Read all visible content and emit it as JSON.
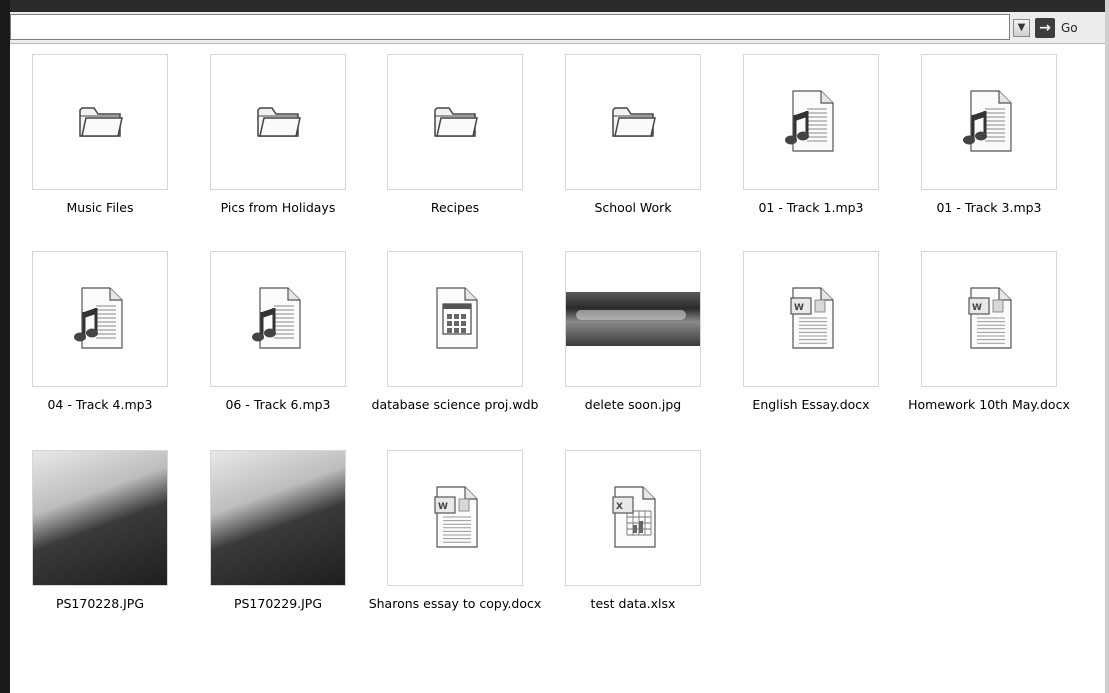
{
  "address_bar": {
    "go_label": "Go"
  },
  "items": [
    {
      "name": "Music Files",
      "kind": "folder"
    },
    {
      "name": "Pics from Holidays",
      "kind": "folder"
    },
    {
      "name": "Recipes",
      "kind": "folder"
    },
    {
      "name": "School Work",
      "kind": "folder"
    },
    {
      "name": "01 - Track 1.mp3",
      "kind": "audio"
    },
    {
      "name": "01 - Track 3.mp3",
      "kind": "audio"
    },
    {
      "name": "04 - Track 4.mp3",
      "kind": "audio"
    },
    {
      "name": "06 - Track 6.mp3",
      "kind": "audio"
    },
    {
      "name": "database science proj.wdb",
      "kind": "database"
    },
    {
      "name": "delete soon.jpg",
      "kind": "photo-landscape"
    },
    {
      "name": "English Essay.docx",
      "kind": "word"
    },
    {
      "name": "Homework 10th May.docx",
      "kind": "word"
    },
    {
      "name": "PS170228.JPG",
      "kind": "photo-horse"
    },
    {
      "name": "PS170229.JPG",
      "kind": "photo-horse"
    },
    {
      "name": "Sharons essay to copy.docx",
      "kind": "word"
    },
    {
      "name": "test data.xlsx",
      "kind": "excel"
    }
  ]
}
